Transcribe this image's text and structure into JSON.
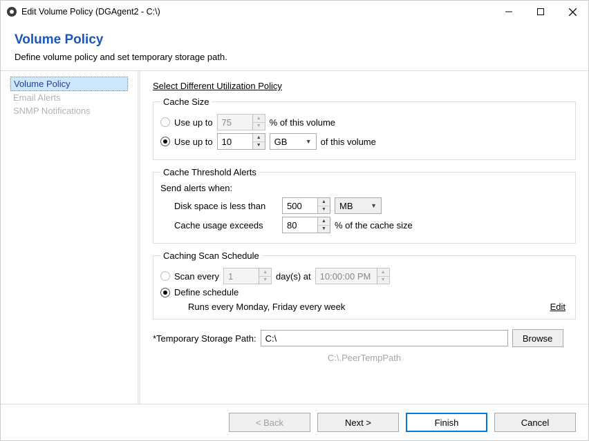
{
  "window": {
    "title": "Edit Volume Policy (DGAgent2 - C:\\)"
  },
  "header": {
    "title": "Volume Policy",
    "subtitle": "Define volume policy and set temporary storage path."
  },
  "sidebar": {
    "items": [
      {
        "label": "Volume Policy",
        "state": "sel"
      },
      {
        "label": "Email Alerts",
        "state": "dis"
      },
      {
        "label": "SNMP Notifications",
        "state": "dis"
      }
    ]
  },
  "link": "Select Different Utilization Policy",
  "cacheSize": {
    "legend": "Cache Size",
    "pctLabel": "Use up to",
    "pctValue": "75",
    "pctSuffix": "% of this volume",
    "absLabel": "Use up to",
    "absValue": "10",
    "absUnit": "GB",
    "absSuffix": "of this volume"
  },
  "alerts": {
    "legend": "Cache Threshold Alerts",
    "intro": "Send alerts when:",
    "diskLabel": "Disk space is less than",
    "diskValue": "500",
    "diskUnit": "MB",
    "usageLabel": "Cache usage exceeds",
    "usageValue": "80",
    "usageSuffix": "% of the cache size"
  },
  "schedule": {
    "legend": "Caching Scan Schedule",
    "everyLabel": "Scan every",
    "everyValue": "1",
    "everyUnit": "day(s) at",
    "everyTime": "10:00:00 PM",
    "defineLabel": "Define schedule",
    "summary": "Runs every Monday, Friday every week",
    "edit": "Edit"
  },
  "tempPath": {
    "label": "*Temporary Storage Path:",
    "value": "C:\\",
    "browse": "Browse",
    "hint": "C:\\.PeerTempPath"
  },
  "footer": {
    "back": "< Back",
    "next": "Next >",
    "finish": "Finish",
    "cancel": "Cancel"
  }
}
